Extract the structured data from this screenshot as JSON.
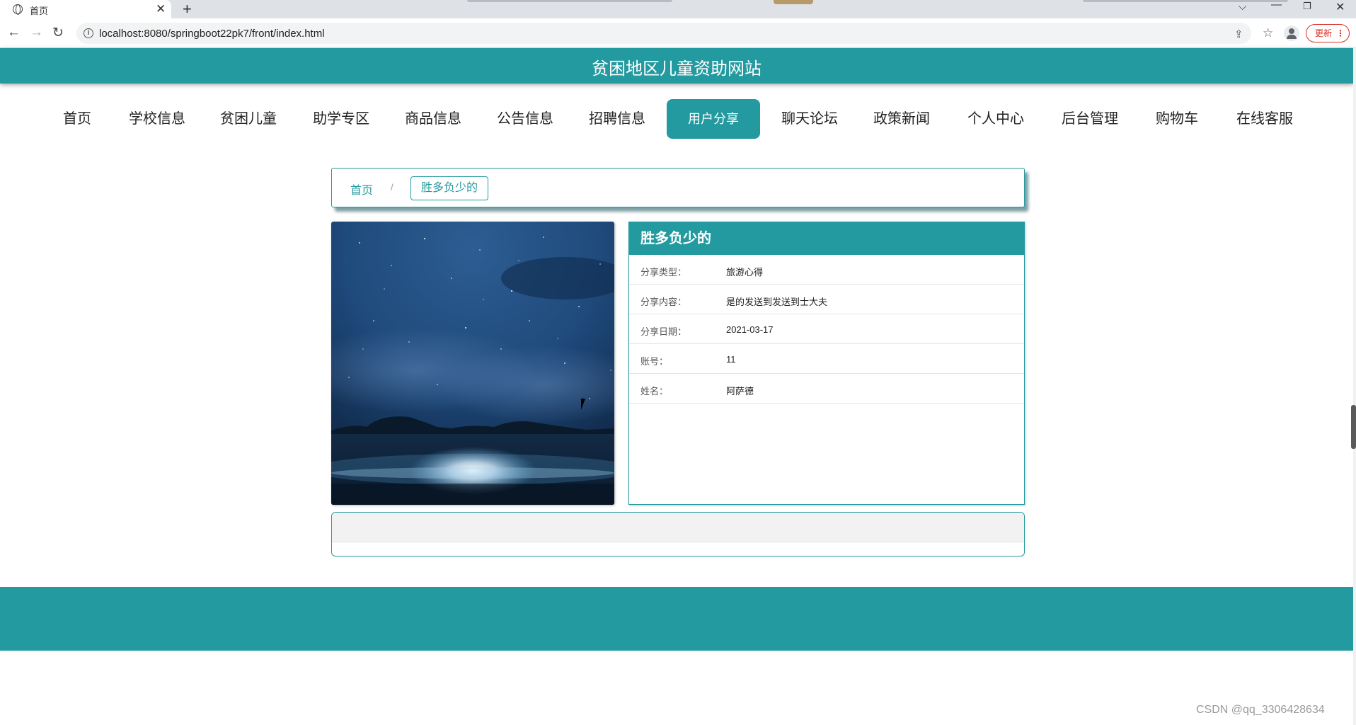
{
  "browser": {
    "tab_title": "首页",
    "url": "localhost:8080/springboot22pk7/front/index.html",
    "update_label": "更新"
  },
  "site": {
    "title": "贫困地区儿童资助网站",
    "accent_color": "#239a9f"
  },
  "nav": {
    "items": [
      "首页",
      "学校信息",
      "贫困儿童",
      "助学专区",
      "商品信息",
      "公告信息",
      "招聘信息",
      "用户分享",
      "聊天论坛",
      "政策新闻",
      "个人中心",
      "后台管理",
      "购物车",
      "在线客服"
    ],
    "active": "用户分享"
  },
  "breadcrumb": {
    "home": "首页",
    "separator": "/",
    "current": "胜多负少的"
  },
  "detail": {
    "title": "胜多负少的",
    "fields": [
      {
        "label": "分享类型：",
        "value": "旅游心得"
      },
      {
        "label": "分享内容：",
        "value": "是的发送到发送到士大夫"
      },
      {
        "label": "分享日期：",
        "value": "2021-03-17"
      },
      {
        "label": "账号：",
        "value": "11"
      },
      {
        "label": "姓名：",
        "value": "阿萨德"
      }
    ]
  },
  "watermark": "CSDN @qq_3306428634"
}
